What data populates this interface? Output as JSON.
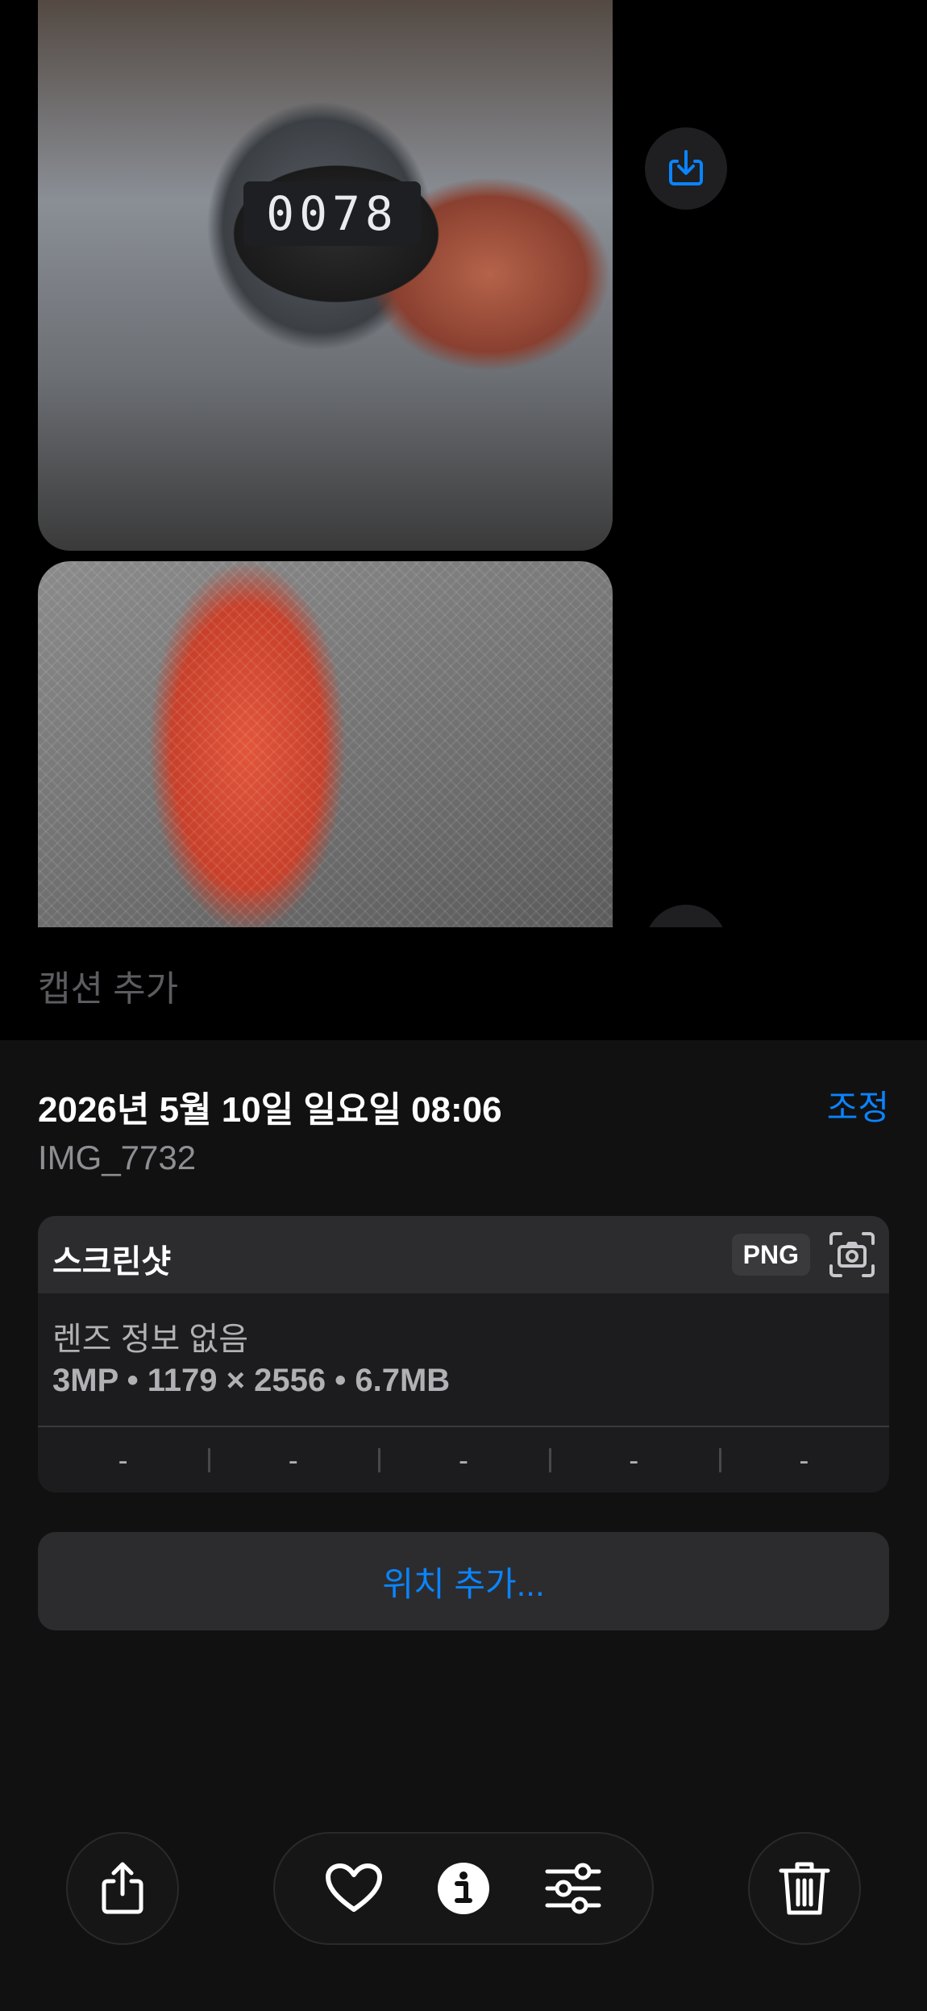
{
  "photo1": {
    "counter_value": "0078"
  },
  "caption_placeholder": "캡션 추가",
  "info": {
    "date": "2026년 5월 10일 일요일 08:06",
    "adjust_label": "조정",
    "filename": "IMG_7732"
  },
  "card": {
    "title": "스크린샷",
    "format_badge": "PNG",
    "lens": "렌즈 정보 없음",
    "specs": "3MP • 1179 × 2556 • 6.7MB",
    "exif": [
      "-",
      "-",
      "-",
      "-",
      "-"
    ]
  },
  "add_location_label": "위치 추가...",
  "toolbar": {
    "icons": [
      "share-icon",
      "heart-icon",
      "info-icon",
      "sliders-icon",
      "trash-icon"
    ]
  },
  "colors": {
    "accent": "#0a84ff",
    "panel_bg": "#111112",
    "card_bg": "#1c1c1e"
  }
}
